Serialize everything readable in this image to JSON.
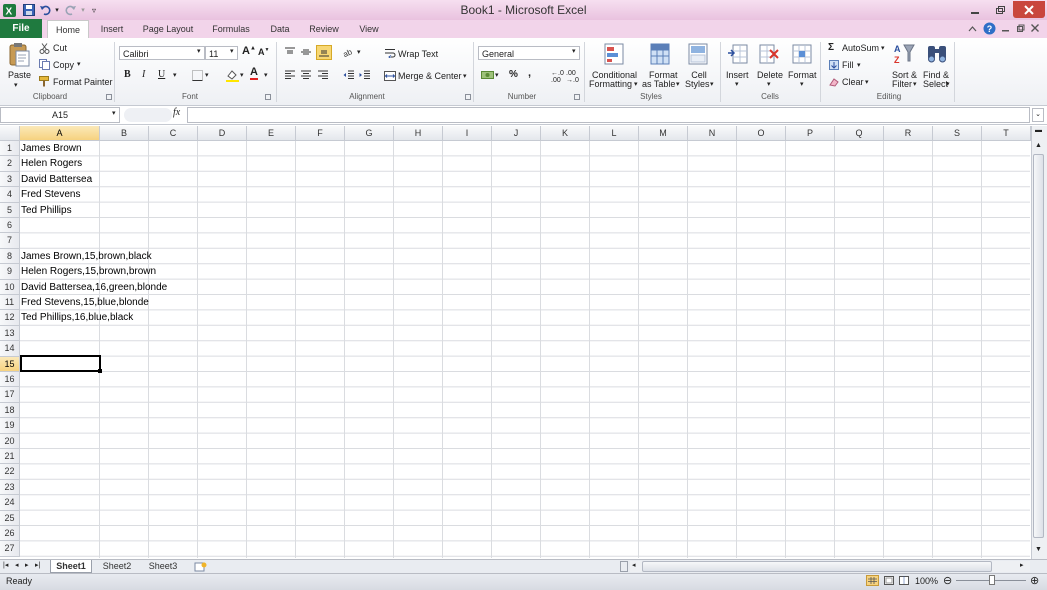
{
  "window": {
    "title": "Book1 - Microsoft Excel"
  },
  "tabs": [
    "File",
    "Home",
    "Insert",
    "Page Layout",
    "Formulas",
    "Data",
    "Review",
    "View"
  ],
  "ribbon": {
    "clipboard": {
      "paste": "Paste",
      "cut": "Cut",
      "copy": "Copy",
      "format_painter": "Format Painter",
      "label": "Clipboard"
    },
    "font": {
      "name": "Calibri",
      "size": "11",
      "label": "Font"
    },
    "alignment": {
      "wrap_text": "Wrap Text",
      "merge_center": "Merge & Center",
      "label": "Alignment"
    },
    "number": {
      "format": "General",
      "label": "Number"
    },
    "styles": {
      "conditional_1": "Conditional",
      "conditional_2": "Formatting",
      "format_table_1": "Format",
      "format_table_2": "as Table",
      "cell_styles_1": "Cell",
      "cell_styles_2": "Styles",
      "label": "Styles"
    },
    "cells": {
      "insert": "Insert",
      "delete": "Delete",
      "format": "Format",
      "label": "Cells"
    },
    "editing": {
      "autosum": "AutoSum",
      "fill": "Fill",
      "clear": "Clear",
      "sort_1": "Sort &",
      "sort_2": "Filter",
      "find_1": "Find &",
      "find_2": "Select",
      "label": "Editing"
    }
  },
  "formula_bar": {
    "name_box": "A15",
    "fx": "fx",
    "formula": ""
  },
  "grid": {
    "columns": [
      "A",
      "B",
      "C",
      "D",
      "E",
      "F",
      "G",
      "H",
      "I",
      "J",
      "K",
      "L",
      "M",
      "N",
      "O",
      "P",
      "Q",
      "R",
      "S",
      "T"
    ],
    "rows": [
      "1",
      "2",
      "3",
      "4",
      "5",
      "6",
      "7",
      "8",
      "9",
      "10",
      "11",
      "12",
      "13",
      "14",
      "15",
      "16",
      "17",
      "18",
      "19",
      "20",
      "21",
      "22",
      "23",
      "24",
      "25",
      "26",
      "27"
    ],
    "cells": [
      {
        "row": 1,
        "text": "James Brown"
      },
      {
        "row": 2,
        "text": "Helen Rogers"
      },
      {
        "row": 3,
        "text": "David Battersea"
      },
      {
        "row": 4,
        "text": "Fred Stevens"
      },
      {
        "row": 5,
        "text": "Ted Phillips"
      },
      {
        "row": 8,
        "text": "James Brown,15,brown,black"
      },
      {
        "row": 9,
        "text": "Helen Rogers,15,brown,brown"
      },
      {
        "row": 10,
        "text": "David Battersea,16,green,blonde"
      },
      {
        "row": 11,
        "text": "Fred Stevens,15,blue,blonde"
      },
      {
        "row": 12,
        "text": "Ted Phillips,16,blue,black"
      }
    ],
    "selected_column": "A",
    "selected_row": "15"
  },
  "sheets": [
    "Sheet1",
    "Sheet2",
    "Sheet3"
  ],
  "active_sheet": "Sheet1",
  "status": {
    "text": "Ready",
    "zoom": "100%"
  },
  "colors": {
    "file_tab": "#1f7a3f",
    "title_bar": "#e9c2df",
    "selection": "#f6d27f"
  }
}
